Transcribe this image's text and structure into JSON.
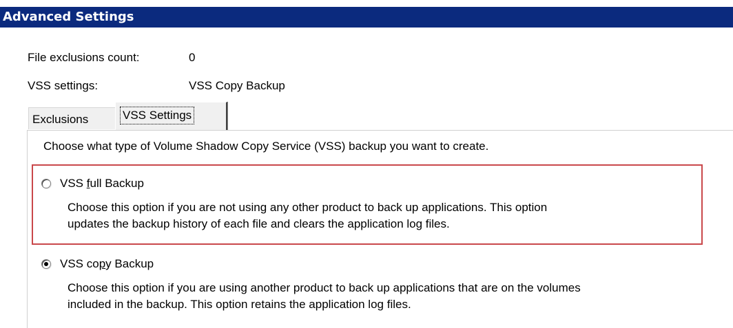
{
  "window": {
    "title": "Advanced Settings"
  },
  "summary": {
    "exclusions_label": "File exclusions count:",
    "exclusions_value": "0",
    "vss_label": "VSS settings:",
    "vss_value": "VSS Copy Backup"
  },
  "tabs": [
    {
      "label": "Exclusions",
      "selected": false
    },
    {
      "label": "VSS Settings",
      "selected": true
    }
  ],
  "panel": {
    "intro": "Choose what type of Volume Shadow Copy Service (VSS) backup you want to create.",
    "options": [
      {
        "label_before": "VSS ",
        "label_accel": "f",
        "label_after": "ull Backup",
        "checked": false,
        "desc_line1": "Choose this option if you are not using any other product to back up applications. This option",
        "desc_line2": "updates the backup history of each file and clears the application log files."
      },
      {
        "label_before": "VSS co",
        "label_accel": "p",
        "label_after": "y Backup",
        "checked": true,
        "desc_line1": "Choose this option if you are using another product to back up applications that are on the volumes",
        "desc_line2": "included in the backup. This option retains the application log files."
      }
    ]
  },
  "colors": {
    "title_bar": "#0b2a7e",
    "highlight_border": "#c9474a"
  }
}
